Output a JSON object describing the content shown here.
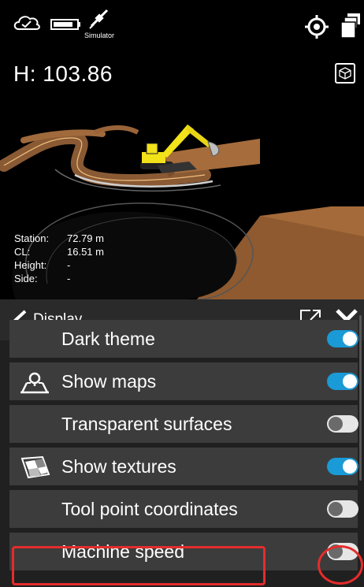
{
  "status": {
    "simulator_label": "Simulator",
    "cloud_icon": "cloud-check-icon",
    "battery_icon": "battery-icon",
    "gps_icon": "satellite-icon",
    "locate_icon": "crosshair-icon",
    "layers_icon": "layers-icon"
  },
  "view": {
    "height_readout": "H: 103.86",
    "cube_icon": "3d-cube-icon"
  },
  "info": {
    "rows": [
      {
        "label": "Station:",
        "value": "72.79 m"
      },
      {
        "label": "CL:",
        "value": "16.51 m"
      },
      {
        "label": "Height:",
        "value": "-"
      },
      {
        "label": "Side:",
        "value": "-"
      }
    ]
  },
  "panel": {
    "title": "Display",
    "back_icon": "chevron-left-icon",
    "popout_icon": "open-external-icon",
    "close_icon": "close-icon",
    "items": [
      {
        "label": "Dark theme",
        "on": true,
        "icon": ""
      },
      {
        "label": "Show maps",
        "on": true,
        "icon": "map-pin-icon"
      },
      {
        "label": "Transparent surfaces",
        "on": false,
        "icon": ""
      },
      {
        "label": "Show textures",
        "on": true,
        "icon": "texture-icon"
      },
      {
        "label": "Tool point coordinates",
        "on": false,
        "icon": ""
      },
      {
        "label": "Machine speed",
        "on": false,
        "icon": ""
      }
    ]
  },
  "colors": {
    "accent": "#1a9ad6",
    "highlight": "#e52c2c",
    "terrain": "#a0683a",
    "excavator": "#f2e21a"
  }
}
